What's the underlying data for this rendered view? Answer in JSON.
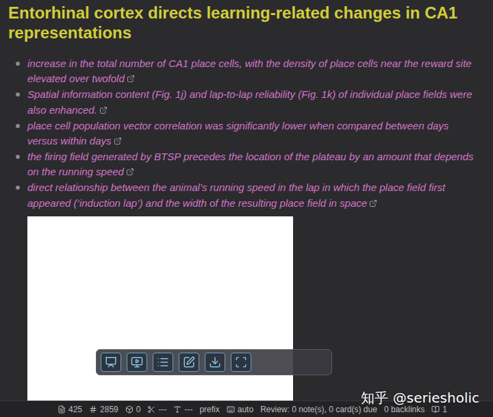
{
  "note": {
    "title": "Entorhinal cortex directs learning-related changes in CA1 representations",
    "bullets": [
      "increase in the total number of CA1 place cells, with the density of place cells near the reward site elevated over twofold",
      "Spatial information content (Fig. 1j) and lap-to-lap reliability (Fig. 1k) of individual place fields were also enhanced.",
      "place cell population vector correlation was significantly lower when compared between days versus within days",
      "the firing field generated by BTSP precedes the location of the plateau by an amount that depends on the running speed",
      "direct relationship between the animal’s running speed in the lap in which the place field first appeared (‘induction lap’) and the width of the resulting place field in space"
    ]
  },
  "status_bar": {
    "items": [
      "425",
      "2859",
      "0",
      "---",
      "---",
      "prefix",
      "auto",
      "Review: 0 note(s), 0 card(s) due",
      "0 backlinks",
      "1"
    ]
  },
  "watermark": "知乎 @seriesholic"
}
